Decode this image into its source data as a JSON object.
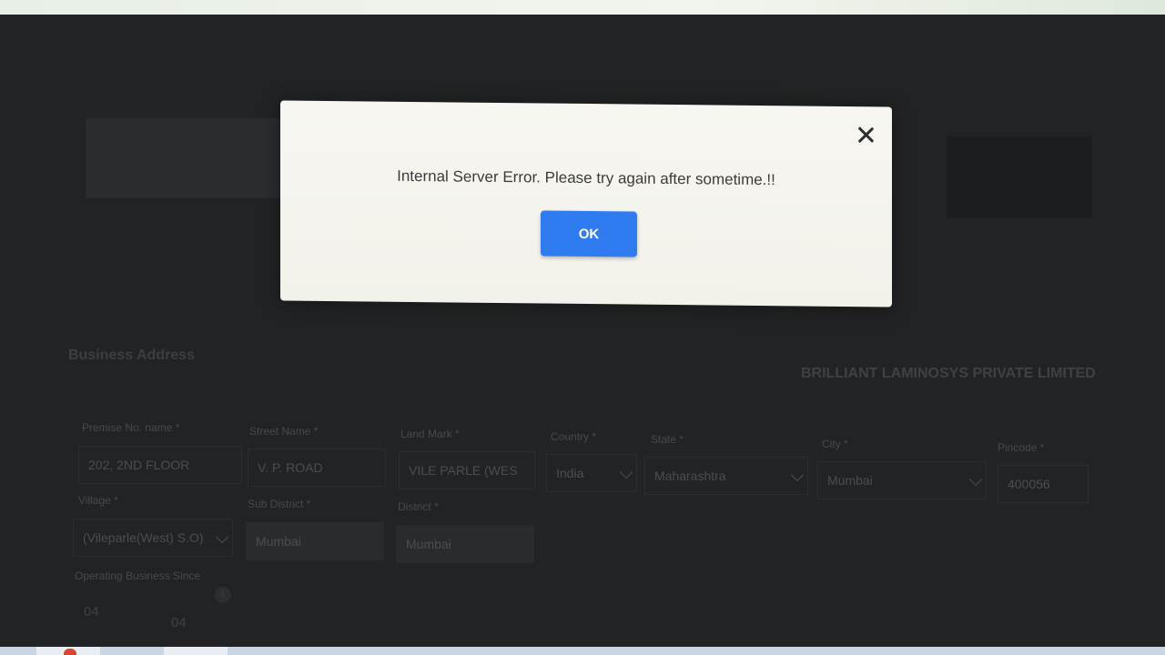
{
  "dialog": {
    "message": "Internal Server Error. Please try again after sometime.!!",
    "ok_label": "OK"
  },
  "form": {
    "section_title": "Business Address",
    "company_name": "BRILLIANT LAMINOSYS PRIVATE LIMITED",
    "fields": {
      "premise": {
        "label": "Premise No. name *",
        "value": "202, 2ND FLOOR"
      },
      "street": {
        "label": "Street Name *",
        "value": "V. P. ROAD"
      },
      "landmark": {
        "label": "Land Mark *",
        "value": "VILE PARLE (WES"
      },
      "country": {
        "label": "Country *",
        "value": "India"
      },
      "state": {
        "label": "State *",
        "value": "Maharashtra"
      },
      "city": {
        "label": "City *",
        "value": "Mumbai"
      },
      "pincode": {
        "label": "Pincode *",
        "value": "400056"
      },
      "village": {
        "label": "Village *",
        "value": "(Vileparle(West) S.O)"
      },
      "sub_district": {
        "label": "Sub District *",
        "value": "Mumbai"
      },
      "district": {
        "label": "District *",
        "value": "Mumbai"
      },
      "operating_since": {
        "label": "Operating Business Since",
        "month": "04",
        "day": "04"
      }
    }
  },
  "icons": [
    "close-icon",
    "chevron-down-icon",
    "info-icon"
  ]
}
